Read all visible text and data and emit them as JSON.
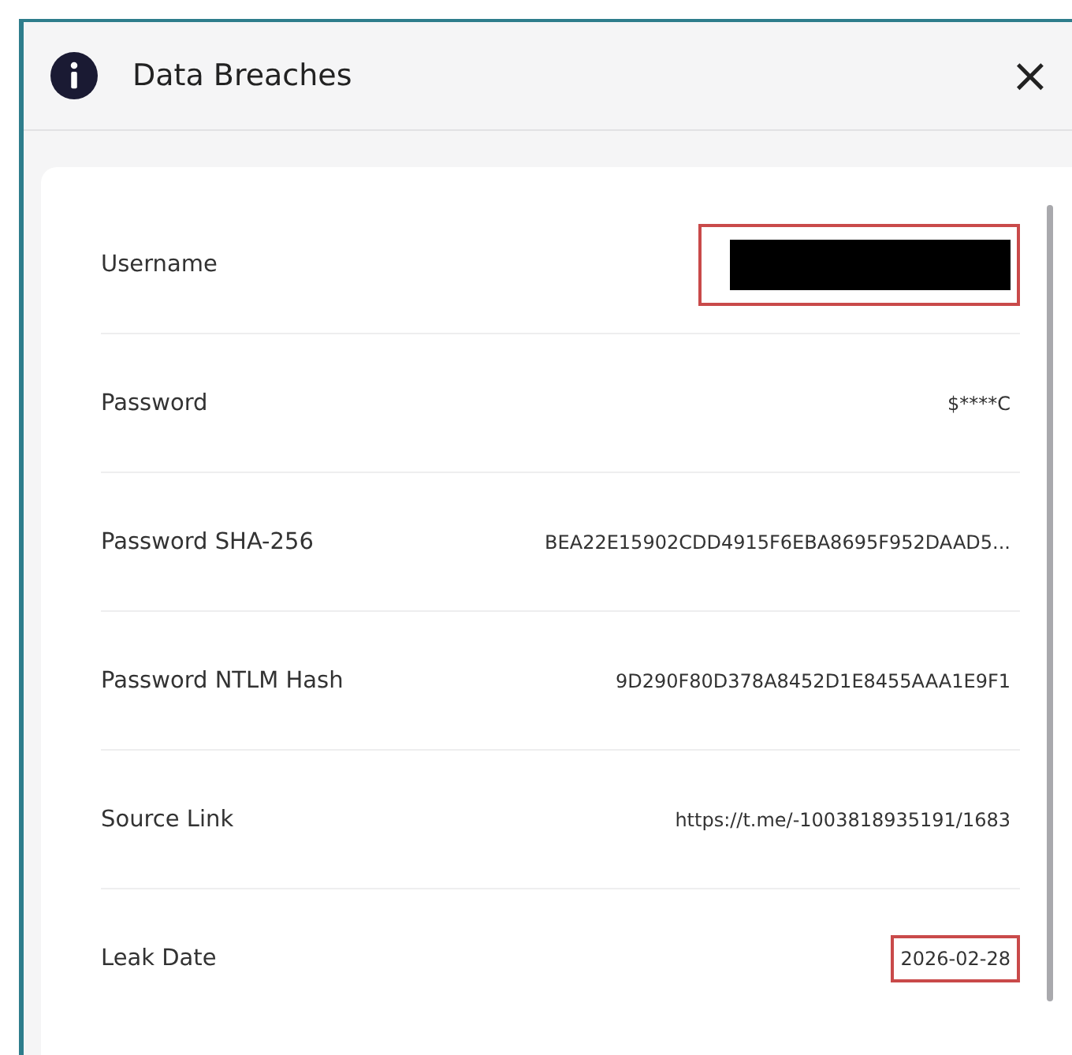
{
  "dialog": {
    "title": "Data Breaches",
    "close": "×"
  },
  "fields": [
    {
      "label": "Username",
      "kind": "redacted",
      "highlighted": true
    },
    {
      "label": "Password",
      "kind": "text",
      "value": "$****C",
      "highlighted": false
    },
    {
      "label": "Password SHA-256",
      "kind": "text",
      "value": "BEA22E15902CDD4915F6EBA8695F952DAAD5...",
      "highlighted": false
    },
    {
      "label": "Password NTLM Hash",
      "kind": "text",
      "value": "9D290F80D378A8452D1E8455AAA1E9F1",
      "highlighted": false
    },
    {
      "label": "Source Link",
      "kind": "text",
      "value": "https://t.me/-1003818935191/1683",
      "highlighted": false
    },
    {
      "label": "Leak Date",
      "kind": "text",
      "value": "2026-02-28",
      "highlighted": true
    }
  ]
}
